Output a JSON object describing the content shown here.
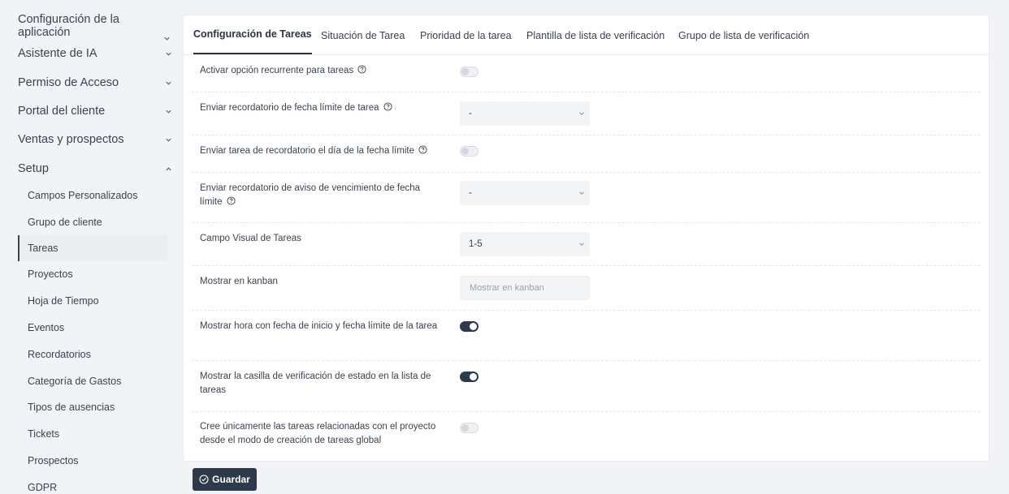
{
  "sidebar": {
    "groups": [
      {
        "label": "Configuración de la aplicación"
      },
      {
        "label": "Asistente de IA"
      },
      {
        "label": "Permiso de Acceso"
      },
      {
        "label": "Portal del cliente"
      },
      {
        "label": "Ventas y prospectos"
      },
      {
        "label": "Setup"
      }
    ],
    "items": [
      {
        "label": "Campos Personalizados"
      },
      {
        "label": "Grupo de cliente"
      },
      {
        "label": "Tareas"
      },
      {
        "label": "Proyectos"
      },
      {
        "label": "Hoja de Tiempo"
      },
      {
        "label": "Eventos"
      },
      {
        "label": "Recordatorios"
      },
      {
        "label": "Categoría de Gastos"
      },
      {
        "label": "Tipos de ausencias"
      },
      {
        "label": "Tickets"
      },
      {
        "label": "Prospectos"
      },
      {
        "label": "GDPR"
      }
    ]
  },
  "tabs": [
    {
      "label": "Configuración de Tareas"
    },
    {
      "label": "Situación de Tarea"
    },
    {
      "label": "Prioridad de la tarea"
    },
    {
      "label": "Plantilla de lista de verificación"
    },
    {
      "label": "Grupo de lista de verificación"
    }
  ],
  "settings": [
    {
      "label": "Activar opción recurrente para tareas",
      "control": "toggle",
      "enabled": false
    },
    {
      "label": "Enviar recordatorio de fecha límite de tarea",
      "control": "select",
      "value": "-"
    },
    {
      "label": "Enviar tarea de recordatorio el día de la fecha límite",
      "control": "toggle",
      "enabled": false
    },
    {
      "label": "Enviar recordatorio de aviso de vencimiento de fecha límite",
      "control": "select",
      "value": "-"
    },
    {
      "label": "Campo Visual de Tareas",
      "control": "select",
      "value": "1-5"
    },
    {
      "label": "Mostrar en kanban",
      "control": "input",
      "placeholder": "Mostrar en kanban"
    },
    {
      "label": "Mostrar hora con fecha de inicio y fecha límite de la tarea",
      "control": "toggle",
      "enabled": true
    },
    {
      "label": "Mostrar la casilla de verificación de estado en la lista de tareas",
      "control": "toggle",
      "enabled": true
    },
    {
      "label": "Cree únicamente las tareas relacionadas con el proyecto desde el modo de creación de tareas global",
      "control": "toggle",
      "enabled": false
    }
  ],
  "actions": {
    "save_label": "Guardar"
  },
  "colors": {
    "accent": "#2e3a4c"
  }
}
